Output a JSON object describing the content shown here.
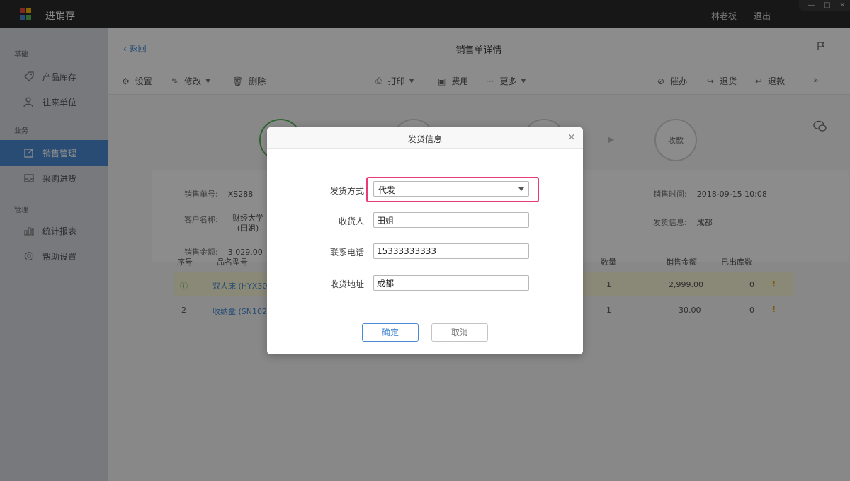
{
  "window": {
    "app_title": "进销存",
    "user_name": "林老板",
    "logout_label": "退出",
    "controls": [
      "—",
      "□",
      "✕"
    ]
  },
  "sidebar": {
    "groups": [
      "基础",
      "业务",
      "管理"
    ],
    "items": [
      {
        "label": "产品库存",
        "icon": "tag-icon"
      },
      {
        "label": "往来单位",
        "icon": "contacts-icon"
      },
      {
        "label": "销售管理",
        "icon": "edit-icon",
        "active": true
      },
      {
        "label": "采购进货",
        "icon": "inbox-icon"
      },
      {
        "label": "统计报表",
        "icon": "bar-chart-icon"
      },
      {
        "label": "帮助设置",
        "icon": "gear-icon"
      }
    ]
  },
  "header": {
    "back_label": "返回",
    "title": "销售单详情"
  },
  "toolbar": {
    "settings": "设置",
    "modify": "修改",
    "delete": "删除",
    "print": "打印",
    "fee": "费用",
    "more": "更多",
    "urge": "催办",
    "return_goods": "退货",
    "refund": "退款"
  },
  "steps": {
    "collect": "收款"
  },
  "order_info": {
    "order_no_label": "销售单号:",
    "order_no": "XS288",
    "customer_label": "客户名称:",
    "customer_line1": "财经大学",
    "customer_line2": "(田姐)",
    "amount_label": "销售金额:",
    "amount": "3,029.00",
    "time_label": "销售时间:",
    "time": "2018-09-15 10:08",
    "ship_label": "发货信息:",
    "ship": "成都"
  },
  "table": {
    "headers": [
      "序号",
      "品名型号",
      "数量",
      "销售金额",
      "已出库数"
    ],
    "rows": [
      {
        "index": "ⓘ",
        "name": "双人床 (HYX300",
        "qty": "1",
        "amount": "2,999.00",
        "out": "0"
      },
      {
        "index": "2",
        "name": "收纳盒 (SN1022",
        "qty": "1",
        "amount": "30.00",
        "out": "0"
      }
    ]
  },
  "modal": {
    "title": "发货信息",
    "close": "×",
    "method_label": "发货方式",
    "method_value": "代发",
    "receiver_label": "收货人",
    "receiver_value": "田姐",
    "phone_label": "联系电话",
    "phone_value": "15333333333",
    "address_label": "收货地址",
    "address_value": "成都",
    "ok_label": "确定",
    "cancel_label": "取消"
  },
  "colors": {
    "accent": "#4a8ad4",
    "highlight": "#ea3a7a",
    "step_done": "#58b85a",
    "warning": "#e3a100"
  }
}
